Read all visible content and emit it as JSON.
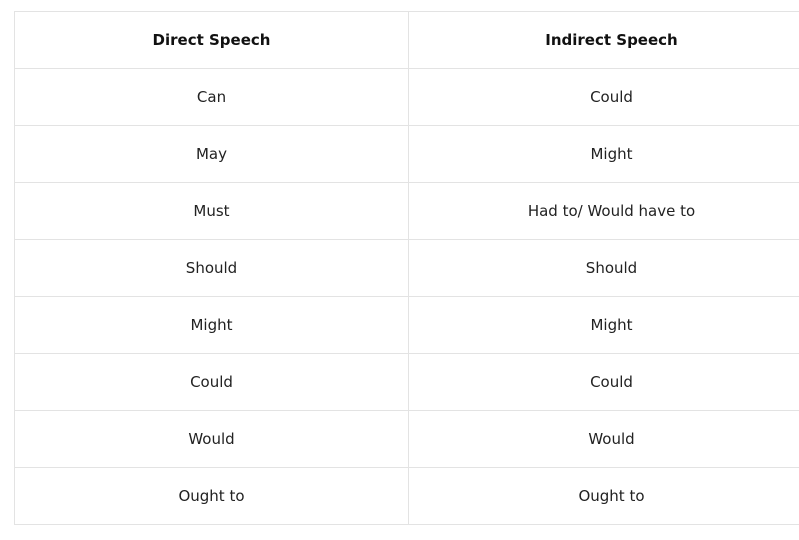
{
  "table": {
    "headers": [
      "Direct Speech",
      "Indirect Speech"
    ],
    "rows": [
      [
        "Can",
        "Could"
      ],
      [
        "May",
        "Might"
      ],
      [
        "Must",
        "Had to/ Would have to"
      ],
      [
        "Should",
        "Should"
      ],
      [
        "Might",
        "Might"
      ],
      [
        "Could",
        "Could"
      ],
      [
        "Would",
        "Would"
      ],
      [
        "Ought to",
        "Ought to"
      ]
    ]
  }
}
